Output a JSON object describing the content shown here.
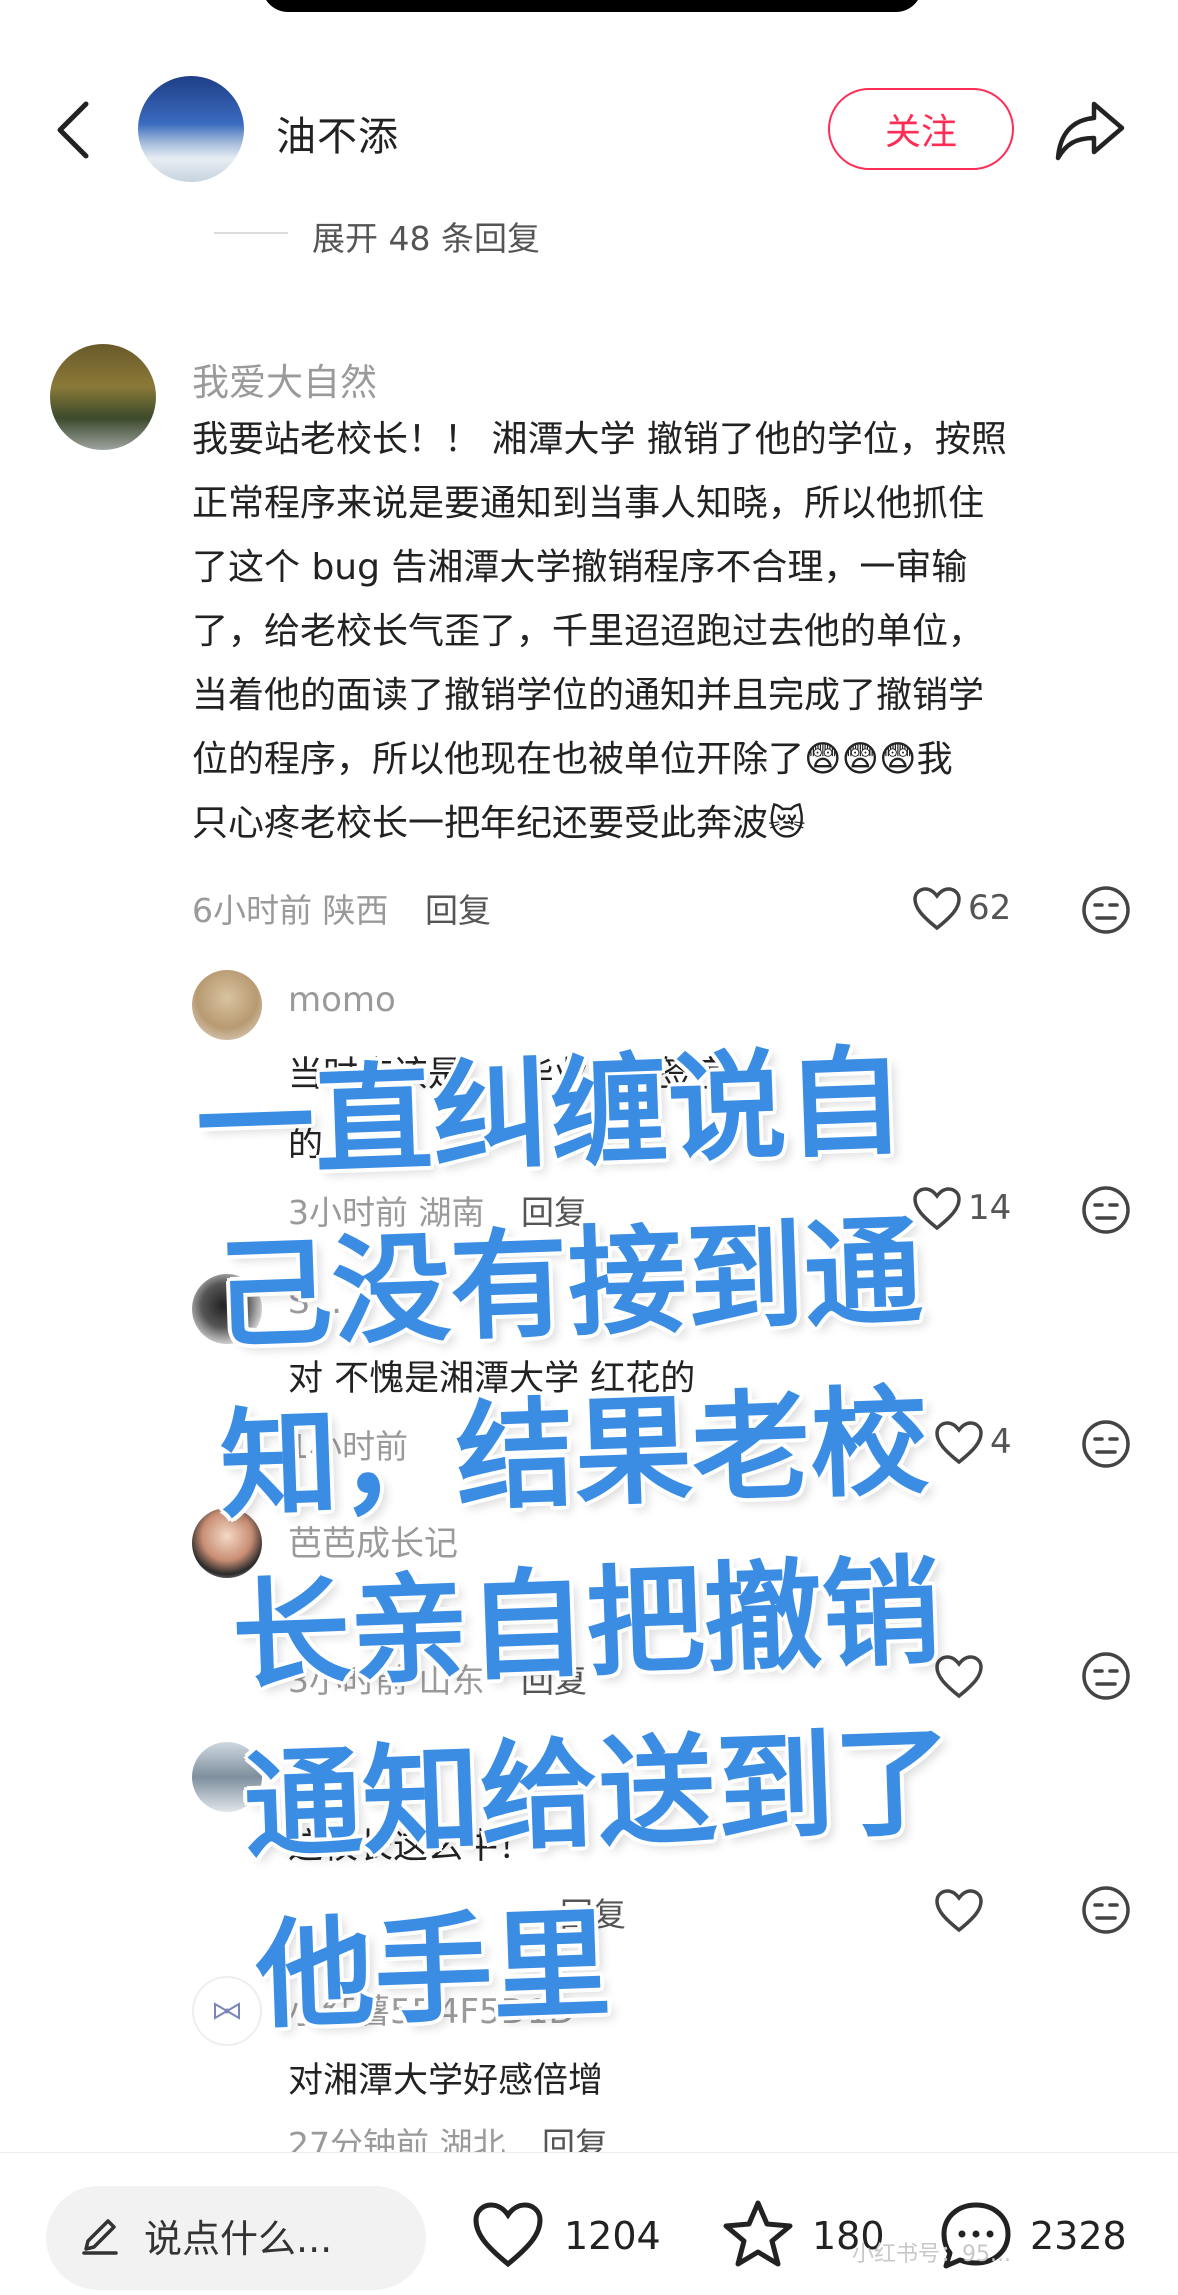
{
  "header": {
    "name": "油不添",
    "follow_label": "关注",
    "expand_text": "展开 48 条回复"
  },
  "comment": {
    "name": "我爱大自然",
    "lines": [
      "我要站老校长！！ 湘潭大学 撤销了他的学位，按照",
      "正常程序来说是要通知到当事人知晓，所以他抓住",
      "了这个 bug 告湘潭大学撤销程序不合理，一审输",
      "了，给老校长气歪了，千里迢迢跑过去他的单位，",
      "当着他的面读了撤销学位的通知并且完成了撤销学",
      "位的程序，所以他现在也被单位开除了😨😨😨我",
      "只心疼老校长一把年纪还要受此奔波😿"
    ],
    "time": "6小时前",
    "location": "陕西",
    "reply_label": "回复",
    "likes": "62"
  },
  "replies": [
    {
      "name": "momo",
      "text_line1": "当时应该是 ... 毕业证上签字",
      "text_line2": "的 ... 长",
      "time": "3小时前",
      "location": "湖南",
      "reply_label": "回复",
      "likes": "14"
    },
    {
      "name": "S...",
      "text": "对 不愧是湘潭大学 红花的",
      "time": "1小时前",
      "location": "",
      "reply_label": "",
      "likes": "4"
    },
    {
      "name": "芭芭成长记",
      "text": "",
      "time": "3小时前",
      "location": "山东",
      "reply_label": "回复",
      "likes": ""
    },
    {
      "name": "",
      "text": "这校长这么牛！",
      "time": "",
      "location": "",
      "reply_label": "回复",
      "likes": ""
    },
    {
      "name": "小红薯5D4F5D1D",
      "text": "对湘潭大学好感倍增",
      "time": "27分钟前",
      "location": "湖北",
      "reply_label": "回复",
      "likes": ""
    }
  ],
  "overlay": {
    "lines": [
      "一直纠缠说自",
      "己没有接到通",
      "知，结果老校",
      "长亲自把撤销",
      "通知给送到了",
      "他手里"
    ]
  },
  "bottom_bar": {
    "input_placeholder": "说点什么...",
    "likes": "1204",
    "favorites": "180",
    "comments": "2328",
    "watermark": "小红书号：95..."
  },
  "colors": {
    "accent": "#ff2d55",
    "overlay_text": "#3b8de4"
  }
}
